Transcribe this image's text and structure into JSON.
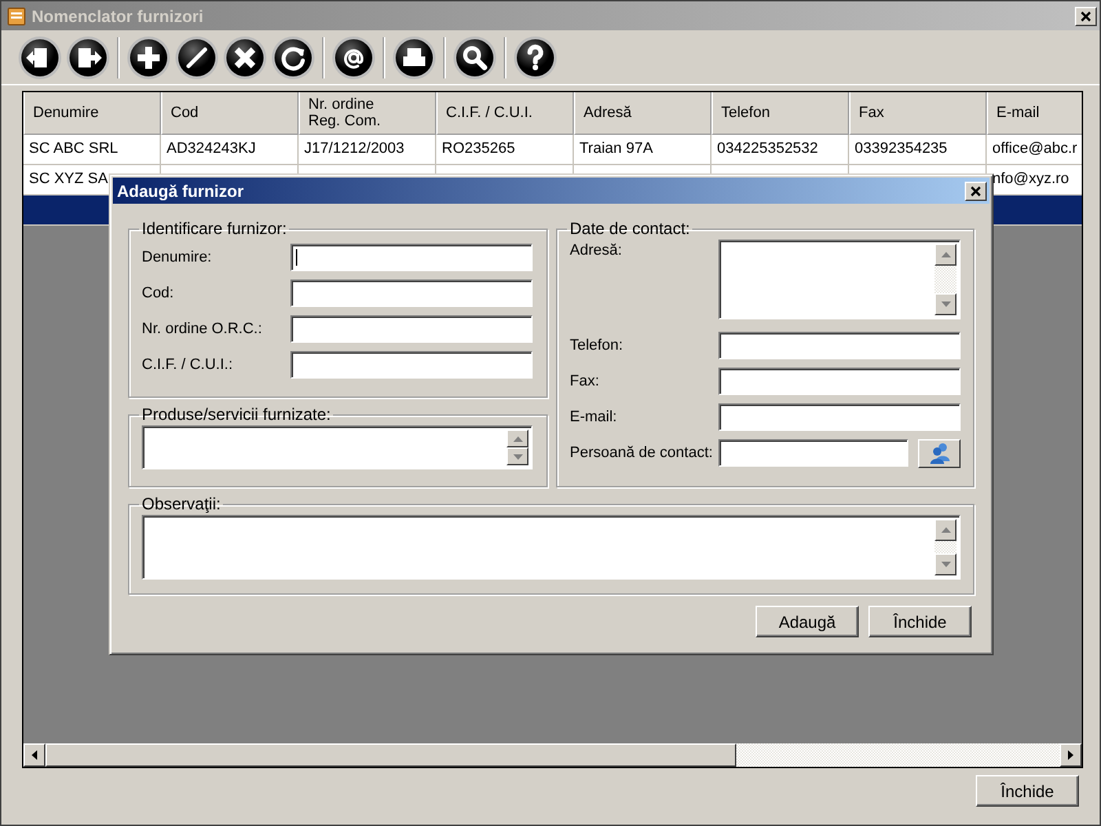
{
  "window": {
    "title": "Nomenclator furnizori"
  },
  "table": {
    "columns": [
      "Denumire",
      "Cod",
      "Nr. ordine\nReg. Com.",
      "C.I.F. / C.U.I.",
      "Adresă",
      "Telefon",
      "Fax",
      "E-mail"
    ],
    "rows": [
      {
        "selected": false,
        "cells": [
          "SC ABC SRL",
          "AD324243KJ",
          "J17/1212/2003",
          "RO235265",
          "Traian 97A",
          "034225352532",
          "03392354235",
          "office@abc.r"
        ]
      },
      {
        "selected": false,
        "cells": [
          "SC XYZ SA",
          null,
          null,
          null,
          null,
          null,
          null,
          "nfo@xyz.ro"
        ]
      },
      {
        "selected": true,
        "cells": [
          null,
          null,
          null,
          null,
          null,
          null,
          null,
          null
        ]
      }
    ]
  },
  "close_button": "Închide",
  "dialog": {
    "title": "Adaugă furnizor",
    "identification": {
      "legend": "Identificare furnizor:",
      "fields": [
        {
          "label": "Denumire:",
          "focused": true
        },
        {
          "label": "Cod:",
          "focused": false
        },
        {
          "label": "Nr. ordine O.R.C.:",
          "focused": false
        },
        {
          "label": "C.I.F. / C.U.I.:",
          "focused": false
        }
      ]
    },
    "products": {
      "legend": "Produse/servicii furnizate:"
    },
    "contact": {
      "legend": "Date de contact:",
      "fields": [
        {
          "label": "Adresă:",
          "kind": "multiline"
        },
        {
          "label": "Telefon:",
          "kind": "text"
        },
        {
          "label": "Fax:",
          "kind": "text"
        },
        {
          "label": "E-mail:",
          "kind": "text"
        },
        {
          "label": "Persoană de contact:",
          "kind": "lookup"
        }
      ]
    },
    "notes": {
      "legend": "Observaţii:"
    },
    "buttons": [
      "Adaugă",
      "Închide"
    ]
  }
}
